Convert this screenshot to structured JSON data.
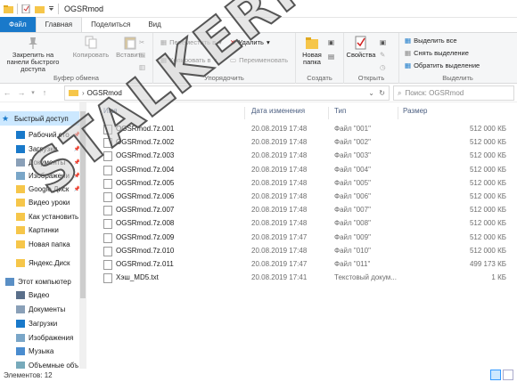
{
  "window": {
    "title": "OGSRmod"
  },
  "tabs": [
    {
      "label": "Файл"
    },
    {
      "label": "Главная"
    },
    {
      "label": "Поделиться"
    },
    {
      "label": "Вид"
    }
  ],
  "ribbon": {
    "clipboard": {
      "pin_label": "Закрепить на панели быстрого доступа",
      "copy_label": "Копировать",
      "paste_label": "Вставить",
      "group_label": "Буфер обмена"
    },
    "organize": {
      "move_label": "Переместить в",
      "copy_to_label": "Копировать в",
      "delete_label": "Удалить",
      "rename_label": "Переименовать",
      "group_label": "Упорядочить"
    },
    "create": {
      "new_folder_label": "Новая папка",
      "group_label": "Создать"
    },
    "open": {
      "properties_label": "Свойства",
      "group_label": "Открыть"
    },
    "select": {
      "select_all_label": "Выделить все",
      "deselect_label": "Снять выделение",
      "invert_label": "Обратить выделение",
      "group_label": "Выделить"
    }
  },
  "address": {
    "path": "OGSRmod",
    "search_placeholder": "Поиск: OGSRmod"
  },
  "nav": {
    "items": [
      {
        "label": "Быстрый доступ",
        "selected": true,
        "pinned": false,
        "icon": "star-icon"
      },
      {
        "label": "Рабочий сто",
        "selected": false,
        "pinned": true,
        "icon": "desktop-icon"
      },
      {
        "label": "Загрузки",
        "selected": false,
        "pinned": true,
        "icon": "download-icon"
      },
      {
        "label": "Документы",
        "selected": false,
        "pinned": true,
        "icon": "document-icon"
      },
      {
        "label": "Изображени",
        "selected": false,
        "pinned": true,
        "icon": "picture-icon"
      },
      {
        "label": "Google Диск",
        "selected": false,
        "pinned": true,
        "icon": "folder-icon"
      },
      {
        "label": "Видео уроки",
        "selected": false,
        "pinned": false,
        "icon": "folder-icon"
      },
      {
        "label": "Как установить",
        "selected": false,
        "pinned": false,
        "icon": "folder-icon"
      },
      {
        "label": "Картинки",
        "selected": false,
        "pinned": false,
        "icon": "folder-icon"
      },
      {
        "label": "Новая папка",
        "selected": false,
        "pinned": false,
        "icon": "folder-icon"
      },
      {
        "label": "Яндекс.Диск",
        "selected": false,
        "pinned": false,
        "icon": "folder-icon"
      },
      {
        "label": "Этот компьютер",
        "selected": false,
        "pinned": false,
        "icon": "computer-icon"
      },
      {
        "label": "Видео",
        "selected": false,
        "pinned": false,
        "icon": "video-icon"
      },
      {
        "label": "Документы",
        "selected": false,
        "pinned": false,
        "icon": "document-icon"
      },
      {
        "label": "Загрузки",
        "selected": false,
        "pinned": false,
        "icon": "download-icon"
      },
      {
        "label": "Изображения",
        "selected": false,
        "pinned": false,
        "icon": "picture-icon"
      },
      {
        "label": "Музыка",
        "selected": false,
        "pinned": false,
        "icon": "music-icon"
      },
      {
        "label": "Объемные объ",
        "selected": false,
        "pinned": false,
        "icon": "cube-icon"
      }
    ]
  },
  "list": {
    "headers": {
      "name": "Имя",
      "date": "Дата изменения",
      "type": "Тип",
      "size": "Размер"
    },
    "rows": [
      {
        "name": "OGSRmod.7z.001",
        "date": "20.08.2019 17:48",
        "type": "Файл \"001\"",
        "size": "512 000 КБ"
      },
      {
        "name": "OGSRmod.7z.002",
        "date": "20.08.2019 17:48",
        "type": "Файл \"002\"",
        "size": "512 000 КБ"
      },
      {
        "name": "OGSRmod.7z.003",
        "date": "20.08.2019 17:48",
        "type": "Файл \"003\"",
        "size": "512 000 КБ"
      },
      {
        "name": "OGSRmod.7z.004",
        "date": "20.08.2019 17:48",
        "type": "Файл \"004\"",
        "size": "512 000 КБ"
      },
      {
        "name": "OGSRmod.7z.005",
        "date": "20.08.2019 17:48",
        "type": "Файл \"005\"",
        "size": "512 000 КБ"
      },
      {
        "name": "OGSRmod.7z.006",
        "date": "20.08.2019 17:48",
        "type": "Файл \"006\"",
        "size": "512 000 КБ"
      },
      {
        "name": "OGSRmod.7z.007",
        "date": "20.08.2019 17:48",
        "type": "Файл \"007\"",
        "size": "512 000 КБ"
      },
      {
        "name": "OGSRmod.7z.008",
        "date": "20.08.2019 17:48",
        "type": "Файл \"008\"",
        "size": "512 000 КБ"
      },
      {
        "name": "OGSRmod.7z.009",
        "date": "20.08.2019 17:47",
        "type": "Файл \"009\"",
        "size": "512 000 КБ"
      },
      {
        "name": "OGSRmod.7z.010",
        "date": "20.08.2019 17:48",
        "type": "Файл \"010\"",
        "size": "512 000 КБ"
      },
      {
        "name": "OGSRmod.7z.011",
        "date": "20.08.2019 17:47",
        "type": "Файл \"011\"",
        "size": "499 173 КБ"
      },
      {
        "name": "Хэш_MD5.txt",
        "date": "20.08.2019 17:41",
        "type": "Текстовый докум...",
        "size": "1 КБ"
      }
    ]
  },
  "status": {
    "text": "Элементов: 12"
  },
  "watermark": {
    "text": "STALKERMODS.RU"
  },
  "colors": {
    "accent": "#1979ca",
    "selection": "#cce8ff",
    "folder": "#f6c64a"
  }
}
